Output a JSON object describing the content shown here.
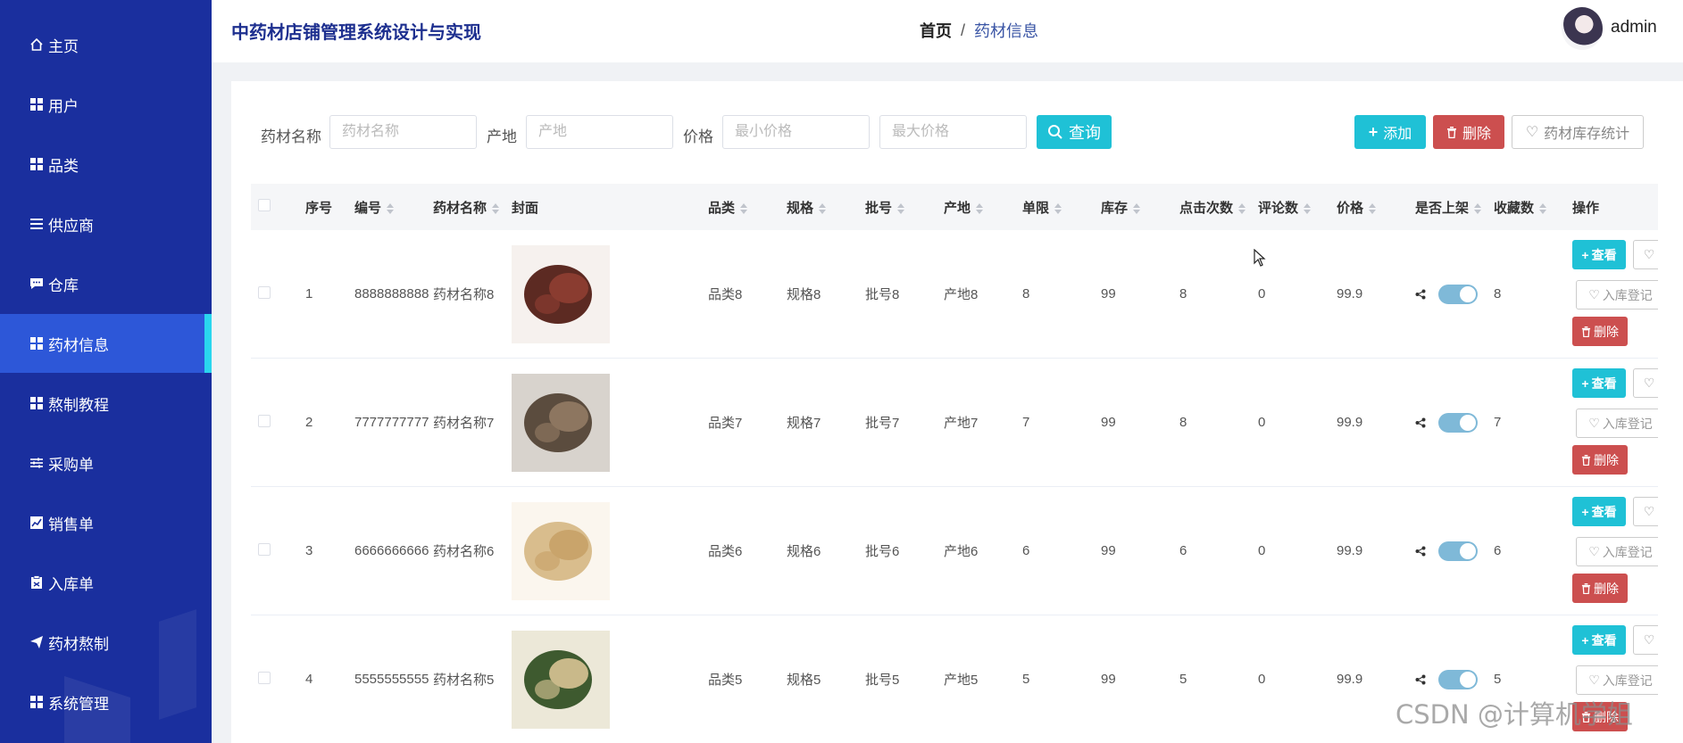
{
  "sidebar": {
    "items": [
      {
        "label": "主页",
        "icon": "home-icon",
        "active": false
      },
      {
        "label": "用户",
        "icon": "grid-icon",
        "active": false
      },
      {
        "label": "品类",
        "icon": "grid-icon",
        "active": false
      },
      {
        "label": "供应商",
        "icon": "list-icon",
        "active": false
      },
      {
        "label": "仓库",
        "icon": "chat-icon",
        "active": false
      },
      {
        "label": "药材信息",
        "icon": "grid-icon",
        "active": true
      },
      {
        "label": "熬制教程",
        "icon": "grid-icon",
        "active": false
      },
      {
        "label": "采购单",
        "icon": "sliders-icon",
        "active": false
      },
      {
        "label": "销售单",
        "icon": "chart-icon",
        "active": false
      },
      {
        "label": "入库单",
        "icon": "clipboard-icon",
        "active": false
      },
      {
        "label": "药材熬制",
        "icon": "paper-plane-icon",
        "active": false
      },
      {
        "label": "系统管理",
        "icon": "grid-icon",
        "active": false
      }
    ],
    "accent_color": "#1a2f9e",
    "active_color": "#2d57d8",
    "indicator_color": "#2ad6ee"
  },
  "header": {
    "title": "中药材店铺管理系统设计与实现",
    "breadcrumb_home": "首页",
    "breadcrumb_separator": "/",
    "breadcrumb_current": "药材信息",
    "username": "admin"
  },
  "filters": {
    "name_label": "药材名称",
    "name_placeholder": "药材名称",
    "origin_label": "产地",
    "origin_placeholder": "产地",
    "price_label": "价格",
    "min_price_placeholder": "最小价格",
    "max_price_placeholder": "最大价格",
    "query_label": "查询"
  },
  "toolbar": {
    "add_label": "添加",
    "delete_label": "删除",
    "stats_label": "药材库存统计"
  },
  "table": {
    "columns": {
      "index": "序号",
      "code": "编号",
      "name": "药材名称",
      "cover": "封面",
      "category": "品类",
      "spec": "规格",
      "batch": "批号",
      "origin": "产地",
      "limit": "单限",
      "stock": "库存",
      "clicks": "点击次数",
      "comments": "评论数",
      "price": "价格",
      "listed": "是否上架",
      "favorites": "收藏数",
      "actions": "操作"
    },
    "rows": [
      {
        "index": "1",
        "code": "8888888888",
        "name": "药材名称8",
        "category": "品类8",
        "spec": "规格8",
        "batch": "批号8",
        "origin": "产地8",
        "limit": "8",
        "stock": "99",
        "clicks": "8",
        "comments": "0",
        "price": "99.9",
        "listed": true,
        "favorites": "8",
        "cover_colors": [
          "#f6f1ee",
          "#5c2a22",
          "#8a3c30"
        ]
      },
      {
        "index": "2",
        "code": "7777777777",
        "name": "药材名称7",
        "category": "品类7",
        "spec": "规格7",
        "batch": "批号7",
        "origin": "产地7",
        "limit": "7",
        "stock": "99",
        "clicks": "8",
        "comments": "0",
        "price": "99.9",
        "listed": true,
        "favorites": "7",
        "cover_colors": [
          "#d8d3cd",
          "#5b4c3e",
          "#8d7660"
        ]
      },
      {
        "index": "3",
        "code": "6666666666",
        "name": "药材名称6",
        "category": "品类6",
        "spec": "规格6",
        "batch": "批号6",
        "origin": "产地6",
        "limit": "6",
        "stock": "99",
        "clicks": "6",
        "comments": "0",
        "price": "99.9",
        "listed": true,
        "favorites": "6",
        "cover_colors": [
          "#fbf6ee",
          "#d9bd8d",
          "#c9a46b"
        ]
      },
      {
        "index": "4",
        "code": "5555555555",
        "name": "药材名称5",
        "category": "品类5",
        "spec": "规格5",
        "batch": "批号5",
        "origin": "产地5",
        "limit": "5",
        "stock": "99",
        "clicks": "5",
        "comments": "0",
        "price": "99.9",
        "listed": true,
        "favorites": "5",
        "cover_colors": [
          "#ece8d8",
          "#3e5a2f",
          "#c9b98a"
        ]
      }
    ],
    "view_label": "查看",
    "stock_in_label": "入库登记",
    "row_delete_label": "删除"
  },
  "watermark": "CSDN @计算机学姐"
}
